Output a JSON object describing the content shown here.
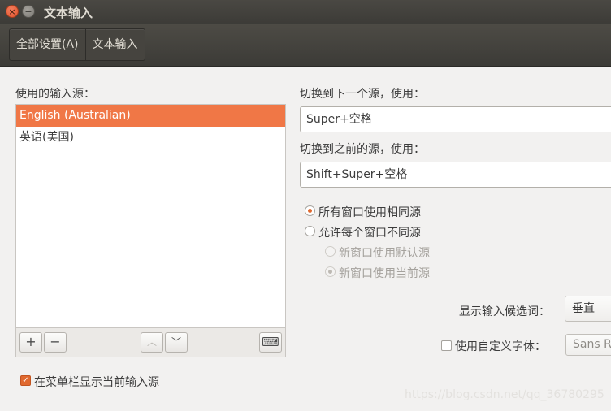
{
  "window": {
    "title": "文本输入",
    "close_glyph": "×",
    "minimize_glyph": "−"
  },
  "toolbar": {
    "crumbs": [
      "全部设置(A)",
      "文本输入"
    ]
  },
  "sources": {
    "label": "使用的输入源：",
    "items": [
      "English (Australian)",
      "英语(美国)"
    ],
    "selected_index": 0,
    "buttons": {
      "add": "+",
      "remove": "−",
      "up": "︿",
      "down": "﹀",
      "keyboard": "⌨"
    }
  },
  "switch_next": {
    "label": "切换到下一个源，使用：",
    "value": "Super+空格"
  },
  "switch_prev": {
    "label": "切换到之前的源，使用：",
    "value": "Shift+Super+空格"
  },
  "window_mode": {
    "same_source": "所有窗口使用相同源",
    "per_window": "允许每个窗口不同源",
    "new_default": "新窗口使用默认源",
    "new_current": "新窗口使用当前源",
    "selected": "same_source"
  },
  "candidates": {
    "label": "显示输入候选词：",
    "value": "垂直"
  },
  "custom_font": {
    "label": "使用自定义字体：",
    "value": "Sans Re",
    "checked": false
  },
  "show_menubar": {
    "label": "在菜单栏显示当前输入源",
    "checked": true,
    "check_glyph": "✓"
  },
  "watermark": "https://blog.csdn.net/qq_36780295"
}
